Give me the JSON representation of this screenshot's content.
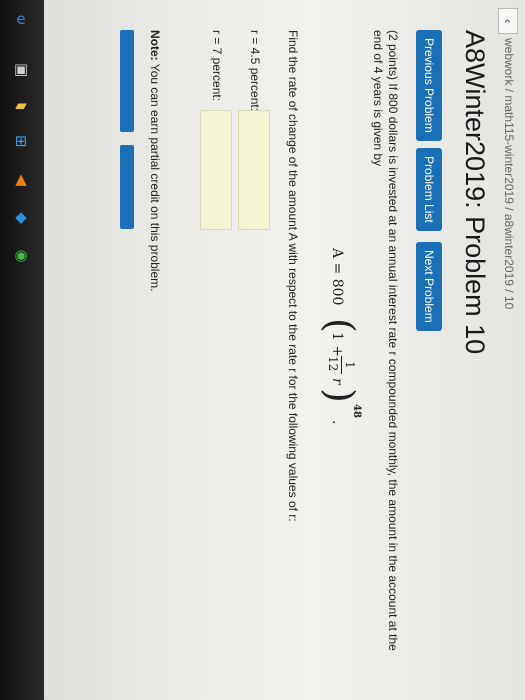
{
  "breadcrumb": "webwork / math115-winter2019 / a8winter2019 / 10",
  "nav_back_glyph": "‹",
  "title": "A8Winter2019: Problem 10",
  "nav": {
    "previous": "Previous Problem",
    "list": "Problem List",
    "next": "Next Problem"
  },
  "problem": {
    "statement": "(2 points) If 800 dollars is invested at an annual interest rate r compounded monthly, the amount in the account at the end of 4 years is given by",
    "formula": {
      "lhs": "A = 800",
      "one": "1 +",
      "num": "1",
      "den": "12",
      "var": "r",
      "exponent": "48",
      "tail": "."
    },
    "find": "Find the rate of change of the amount A with respect to the rate r for the following values of r:"
  },
  "answers": [
    {
      "label": "r = 4.5 percent:",
      "value": ""
    },
    {
      "label": "r = 7 percent:",
      "value": ""
    }
  ],
  "note": {
    "bold": "Note:",
    "text": " You can earn partial credit on this problem."
  },
  "taskbar": {
    "icons": [
      {
        "name": "edge-icon",
        "glyph": "e",
        "color": "#2b8de0"
      },
      {
        "name": "store-icon",
        "glyph": "▣",
        "color": "#d0d0d0"
      },
      {
        "name": "folder-icon",
        "glyph": "▰",
        "color": "#f0c040"
      },
      {
        "name": "windows-icon",
        "glyph": "⊞",
        "color": "#3aa0f0"
      },
      {
        "name": "vlc-icon",
        "glyph": "▲",
        "color": "#f07a10"
      },
      {
        "name": "app-icon",
        "glyph": "◆",
        "color": "#2a8fe0"
      },
      {
        "name": "media-icon",
        "glyph": "◉",
        "color": "#40c040"
      }
    ]
  }
}
